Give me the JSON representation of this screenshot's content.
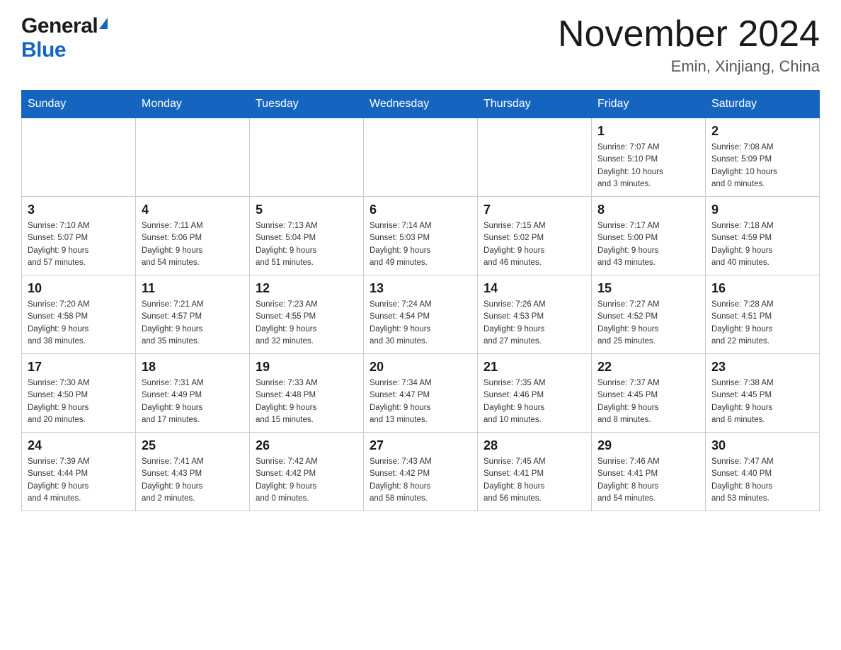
{
  "header": {
    "title": "November 2024",
    "subtitle": "Emin, Xinjiang, China"
  },
  "logo": {
    "general": "General",
    "blue": "Blue"
  },
  "weekdays": [
    "Sunday",
    "Monday",
    "Tuesday",
    "Wednesday",
    "Thursday",
    "Friday",
    "Saturday"
  ],
  "weeks": [
    [
      {
        "day": "",
        "info": ""
      },
      {
        "day": "",
        "info": ""
      },
      {
        "day": "",
        "info": ""
      },
      {
        "day": "",
        "info": ""
      },
      {
        "day": "",
        "info": ""
      },
      {
        "day": "1",
        "info": "Sunrise: 7:07 AM\nSunset: 5:10 PM\nDaylight: 10 hours\nand 3 minutes."
      },
      {
        "day": "2",
        "info": "Sunrise: 7:08 AM\nSunset: 5:09 PM\nDaylight: 10 hours\nand 0 minutes."
      }
    ],
    [
      {
        "day": "3",
        "info": "Sunrise: 7:10 AM\nSunset: 5:07 PM\nDaylight: 9 hours\nand 57 minutes."
      },
      {
        "day": "4",
        "info": "Sunrise: 7:11 AM\nSunset: 5:06 PM\nDaylight: 9 hours\nand 54 minutes."
      },
      {
        "day": "5",
        "info": "Sunrise: 7:13 AM\nSunset: 5:04 PM\nDaylight: 9 hours\nand 51 minutes."
      },
      {
        "day": "6",
        "info": "Sunrise: 7:14 AM\nSunset: 5:03 PM\nDaylight: 9 hours\nand 49 minutes."
      },
      {
        "day": "7",
        "info": "Sunrise: 7:15 AM\nSunset: 5:02 PM\nDaylight: 9 hours\nand 46 minutes."
      },
      {
        "day": "8",
        "info": "Sunrise: 7:17 AM\nSunset: 5:00 PM\nDaylight: 9 hours\nand 43 minutes."
      },
      {
        "day": "9",
        "info": "Sunrise: 7:18 AM\nSunset: 4:59 PM\nDaylight: 9 hours\nand 40 minutes."
      }
    ],
    [
      {
        "day": "10",
        "info": "Sunrise: 7:20 AM\nSunset: 4:58 PM\nDaylight: 9 hours\nand 38 minutes."
      },
      {
        "day": "11",
        "info": "Sunrise: 7:21 AM\nSunset: 4:57 PM\nDaylight: 9 hours\nand 35 minutes."
      },
      {
        "day": "12",
        "info": "Sunrise: 7:23 AM\nSunset: 4:55 PM\nDaylight: 9 hours\nand 32 minutes."
      },
      {
        "day": "13",
        "info": "Sunrise: 7:24 AM\nSunset: 4:54 PM\nDaylight: 9 hours\nand 30 minutes."
      },
      {
        "day": "14",
        "info": "Sunrise: 7:26 AM\nSunset: 4:53 PM\nDaylight: 9 hours\nand 27 minutes."
      },
      {
        "day": "15",
        "info": "Sunrise: 7:27 AM\nSunset: 4:52 PM\nDaylight: 9 hours\nand 25 minutes."
      },
      {
        "day": "16",
        "info": "Sunrise: 7:28 AM\nSunset: 4:51 PM\nDaylight: 9 hours\nand 22 minutes."
      }
    ],
    [
      {
        "day": "17",
        "info": "Sunrise: 7:30 AM\nSunset: 4:50 PM\nDaylight: 9 hours\nand 20 minutes."
      },
      {
        "day": "18",
        "info": "Sunrise: 7:31 AM\nSunset: 4:49 PM\nDaylight: 9 hours\nand 17 minutes."
      },
      {
        "day": "19",
        "info": "Sunrise: 7:33 AM\nSunset: 4:48 PM\nDaylight: 9 hours\nand 15 minutes."
      },
      {
        "day": "20",
        "info": "Sunrise: 7:34 AM\nSunset: 4:47 PM\nDaylight: 9 hours\nand 13 minutes."
      },
      {
        "day": "21",
        "info": "Sunrise: 7:35 AM\nSunset: 4:46 PM\nDaylight: 9 hours\nand 10 minutes."
      },
      {
        "day": "22",
        "info": "Sunrise: 7:37 AM\nSunset: 4:45 PM\nDaylight: 9 hours\nand 8 minutes."
      },
      {
        "day": "23",
        "info": "Sunrise: 7:38 AM\nSunset: 4:45 PM\nDaylight: 9 hours\nand 6 minutes."
      }
    ],
    [
      {
        "day": "24",
        "info": "Sunrise: 7:39 AM\nSunset: 4:44 PM\nDaylight: 9 hours\nand 4 minutes."
      },
      {
        "day": "25",
        "info": "Sunrise: 7:41 AM\nSunset: 4:43 PM\nDaylight: 9 hours\nand 2 minutes."
      },
      {
        "day": "26",
        "info": "Sunrise: 7:42 AM\nSunset: 4:42 PM\nDaylight: 9 hours\nand 0 minutes."
      },
      {
        "day": "27",
        "info": "Sunrise: 7:43 AM\nSunset: 4:42 PM\nDaylight: 8 hours\nand 58 minutes."
      },
      {
        "day": "28",
        "info": "Sunrise: 7:45 AM\nSunset: 4:41 PM\nDaylight: 8 hours\nand 56 minutes."
      },
      {
        "day": "29",
        "info": "Sunrise: 7:46 AM\nSunset: 4:41 PM\nDaylight: 8 hours\nand 54 minutes."
      },
      {
        "day": "30",
        "info": "Sunrise: 7:47 AM\nSunset: 4:40 PM\nDaylight: 8 hours\nand 53 minutes."
      }
    ]
  ]
}
